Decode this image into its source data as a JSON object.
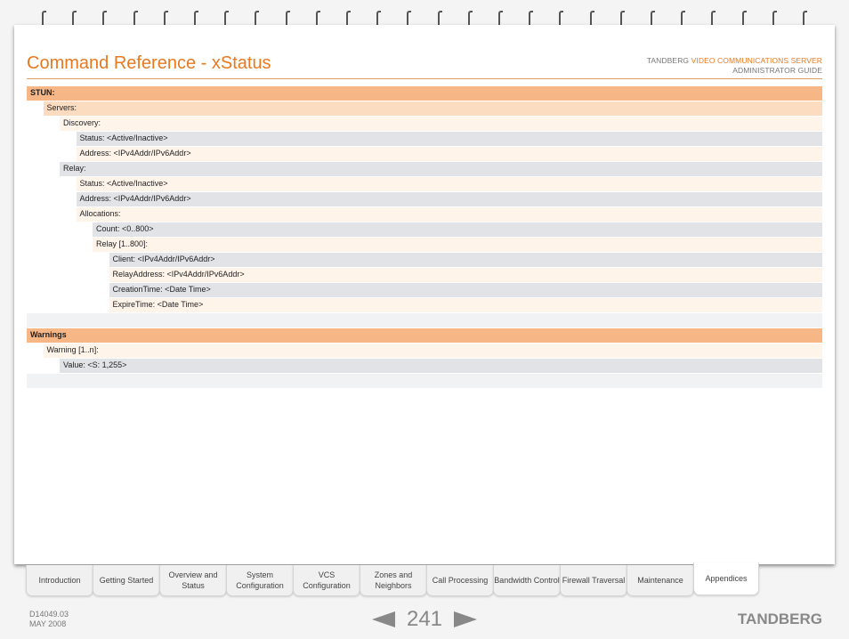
{
  "header": {
    "title": "Command Reference - xStatus",
    "brand": "TANDBERG",
    "product": "VIDEO COMMUNICATIONS SERVER",
    "guide": "ADMINISTRATOR GUIDE"
  },
  "rows": [
    {
      "text": "STUN:",
      "level": 0,
      "style": "head",
      "bold": true
    },
    {
      "text": "Servers:",
      "level": 1,
      "style": "peach"
    },
    {
      "text": "Discovery:",
      "level": 2,
      "style": "cream"
    },
    {
      "text": "Status: <Active/Inactive>",
      "level": 3,
      "style": "gray"
    },
    {
      "text": "Address: <IPv4Addr/IPv6Addr>",
      "level": 3,
      "style": "cream"
    },
    {
      "text": "Relay:",
      "level": 2,
      "style": "gray"
    },
    {
      "text": "Status: <Active/Inactive>",
      "level": 3,
      "style": "cream"
    },
    {
      "text": "Address: <IPv4Addr/IPv6Addr>",
      "level": 3,
      "style": "gray"
    },
    {
      "text": "Allocations:",
      "level": 3,
      "style": "cream"
    },
    {
      "text": "Count: <0..800>",
      "level": 4,
      "style": "gray"
    },
    {
      "text": "Relay [1..800]:",
      "level": 4,
      "style": "cream"
    },
    {
      "text": "Client: <IPv4Addr/IPv6Addr>",
      "level": 5,
      "style": "gray"
    },
    {
      "text": "RelayAddress: <IPv4Addr/IPv6Addr>",
      "level": 5,
      "style": "cream"
    },
    {
      "text": "CreationTime: <Date Time>",
      "level": 5,
      "style": "gray"
    },
    {
      "text": "ExpireTime: <Date Time>",
      "level": 5,
      "style": "cream"
    },
    {
      "text": "",
      "level": 0,
      "style": "blank"
    },
    {
      "text": "Warnings",
      "suffix": ":",
      "level": 0,
      "style": "head",
      "bold": true
    },
    {
      "text": "Warning [1..n]:",
      "level": 1,
      "style": "cream"
    },
    {
      "text": "Value: <S: 1,255>",
      "level": 2,
      "style": "gray"
    },
    {
      "text": "",
      "level": 0,
      "style": "blank"
    }
  ],
  "tabs": [
    {
      "label": "Introduction"
    },
    {
      "label": "Getting Started"
    },
    {
      "label": "Overview and Status"
    },
    {
      "label": "System Configuration"
    },
    {
      "label": "VCS Configuration"
    },
    {
      "label": "Zones and Neighbors"
    },
    {
      "label": "Call Processing"
    },
    {
      "label": "Bandwidth Control"
    },
    {
      "label": "Firewall Traversal"
    },
    {
      "label": "Maintenance"
    },
    {
      "label": "Appendices",
      "active": true
    }
  ],
  "footer": {
    "doc_id": "D14049.03",
    "date": "MAY 2008",
    "page": "241",
    "logo": "TANDBERG"
  }
}
